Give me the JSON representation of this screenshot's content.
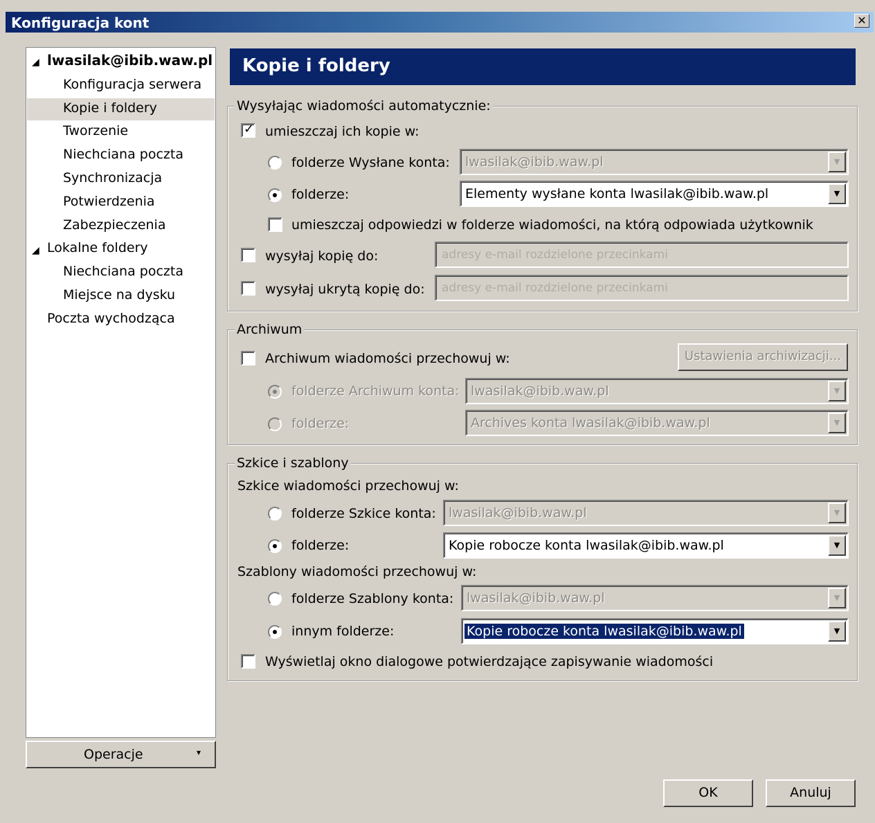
{
  "window": {
    "title": "Konfiguracja kont",
    "close_label": "✕"
  },
  "sidebar": {
    "items": [
      {
        "label": "lwasilak@ibib.waw.pl",
        "expander": "◢"
      },
      {
        "label": "Konfiguracja serwera"
      },
      {
        "label": "Kopie i foldery"
      },
      {
        "label": "Tworzenie"
      },
      {
        "label": "Niechciana poczta"
      },
      {
        "label": "Synchronizacja"
      },
      {
        "label": "Potwierdzenia"
      },
      {
        "label": "Zabezpieczenia"
      },
      {
        "label": "Lokalne foldery",
        "expander": "◢"
      },
      {
        "label": "Niechciana poczta"
      },
      {
        "label": "Miejsce na dysku"
      },
      {
        "label": "Poczta wychodząca"
      }
    ],
    "selected": "Kopie i foldery",
    "operations_button": "Operacje",
    "operations_arrow": "▾"
  },
  "page": {
    "title": "Kopie i foldery"
  },
  "sending": {
    "group_label": "Wysyłając wiadomości automatycznie:",
    "place_copies": {
      "label": "umieszczaj ich kopie w:",
      "checked": true
    },
    "sent_account_folder": {
      "label": "folderze Wysłane konta:",
      "value": "lwasilak@ibib.waw.pl",
      "selected": false
    },
    "other_folder": {
      "label": "folderze:",
      "value": "Elementy wysłane konta lwasilak@ibib.waw.pl",
      "selected": true
    },
    "reply_in_folder": {
      "label": "umieszczaj odpowiedzi w folderze wiadomości, na którą odpowiada użytkownik",
      "checked": false
    },
    "cc": {
      "label": "wysyłaj kopię do:",
      "placeholder": "adresy e-mail rozdzielone przecinkami",
      "checked": false
    },
    "bcc": {
      "label": "wysyłaj ukrytą kopię do:",
      "placeholder": "adresy e-mail rozdzielone przecinkami",
      "checked": false
    }
  },
  "archive": {
    "group_label": "Archiwum",
    "keep": {
      "label": "Archiwum wiadomości przechowuj w:",
      "checked": false
    },
    "settings_button": "Ustawienia archiwizacji...",
    "account_folder": {
      "label": "folderze Archiwum konta:",
      "value": "lwasilak@ibib.waw.pl",
      "selected": true
    },
    "other_folder": {
      "label": "folderze:",
      "value": "Archives konta lwasilak@ibib.waw.pl",
      "selected": false
    }
  },
  "drafts": {
    "group_label": "Szkice i szablony",
    "drafts_label": "Szkice wiadomości przechowuj w:",
    "drafts_account": {
      "label": "folderze Szkice konta:",
      "value": "lwasilak@ibib.waw.pl",
      "selected": false
    },
    "drafts_other": {
      "label": "folderze:",
      "value": "Kopie robocze konta lwasilak@ibib.waw.pl",
      "selected": true
    },
    "templates_label": "Szablony wiadomości przechowuj w:",
    "templates_account": {
      "label": "folderze Szablony konta:",
      "value": "lwasilak@ibib.waw.pl",
      "selected": false
    },
    "templates_other": {
      "label": "innym folderze:",
      "value": "Kopie robocze konta lwasilak@ibib.waw.pl",
      "selected": true
    },
    "confirm_dialog": {
      "label": "Wyświetlaj okno dialogowe potwierdzające zapisywanie wiadomości",
      "checked": false
    }
  },
  "buttons": {
    "ok": "OK",
    "cancel": "Anuluj"
  },
  "icons": {
    "dropdown": "▼",
    "check": "✓"
  },
  "colors": {
    "title_start": "#0a246a",
    "title_end": "#a6caf0",
    "face": "#d4d0c8",
    "selection": "#0a246a"
  }
}
